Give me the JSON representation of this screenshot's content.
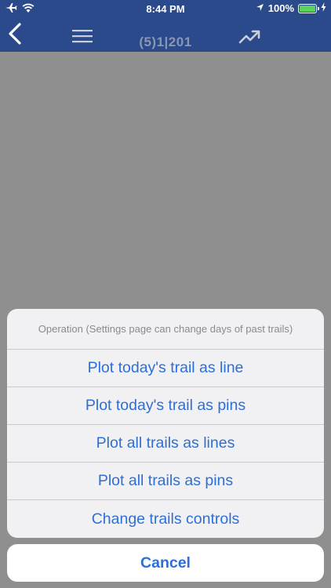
{
  "status_bar": {
    "time": "8:44 PM",
    "battery_text": "100%",
    "battery_level": 1.0,
    "icons": [
      "airplane-icon",
      "wifi-icon",
      "location-arrow-icon",
      "battery-icon",
      "charging-bolt-icon"
    ]
  },
  "nav": {
    "title": "(5)1|201",
    "icons": [
      "back-chevron-icon",
      "hamburger-menu-icon",
      "trend-up-icon"
    ]
  },
  "action_sheet": {
    "header": "Operation (Settings page can change days of past trails)",
    "items": [
      "Plot today's trail as line",
      "Plot today's trail as pins",
      "Plot all trails as lines",
      "Plot all trails as pins",
      "Change trails controls"
    ],
    "cancel_label": "Cancel"
  },
  "colors": {
    "nav_background": "#2b4a8c",
    "dim_overlay": "#8f8f8f",
    "action_text": "#2d6fd8",
    "sheet_background": "#f1f1f3",
    "battery_green": "#5bd35b"
  }
}
